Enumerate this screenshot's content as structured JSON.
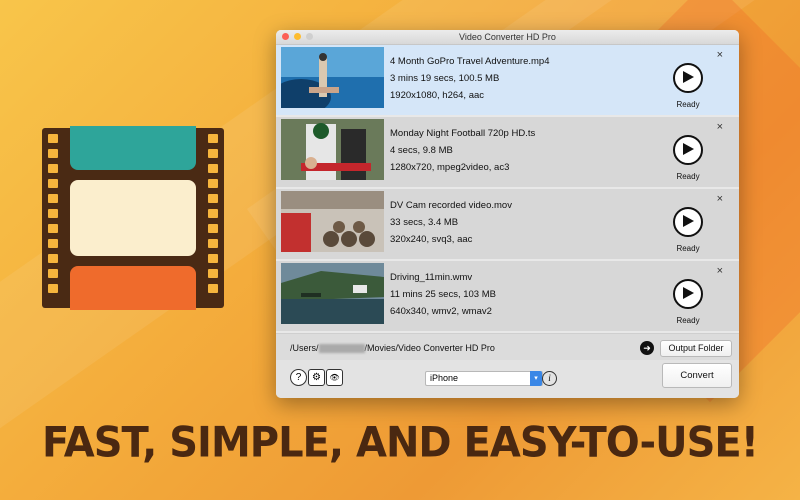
{
  "window": {
    "title": "Video Converter HD Pro"
  },
  "videos": [
    {
      "name": "4 Month GoPro Travel Adventure.mp4",
      "duration_size": "3 mins 19 secs, 100.5 MB",
      "specs": "1920x1080, h264, aac",
      "status": "Ready",
      "selected": true
    },
    {
      "name": "Monday Night Football 720p HD.ts",
      "duration_size": "4 secs, 9.8 MB",
      "specs": "1280x720, mpeg2video, ac3",
      "status": "Ready"
    },
    {
      "name": "DV Cam recorded video.mov",
      "duration_size": "33 secs, 3.4 MB",
      "specs": "320x240, svq3, aac",
      "status": "Ready"
    },
    {
      "name": "Driving_11min.wmv",
      "duration_size": "11 mins 25 secs, 103 MB",
      "specs": "640x340, wmv2, wmav2",
      "status": "Ready"
    }
  ],
  "close_glyph": "×",
  "output": {
    "path_prefix": "/Users/",
    "path_suffix": "/Movies/Video Converter HD Pro",
    "folder_button": "Output Folder",
    "arrow_glyph": "➜"
  },
  "toolbar": {
    "help_glyph": "?",
    "settings_glyph": "⚙",
    "preview_glyph": "👁",
    "device_value": "iPhone",
    "info_glyph": "i",
    "convert_label": "Convert"
  },
  "headline": "FAST, SIMPLE, AND EASY-TO-USE!",
  "colors": {
    "brand_brown": "#4a2811",
    "select_blue": "#3a87e6",
    "row_selected": "#d5e6f8"
  }
}
